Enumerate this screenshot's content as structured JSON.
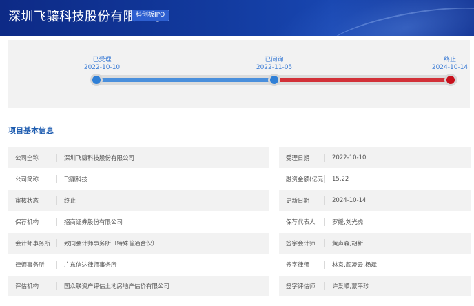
{
  "header": {
    "company_name": "深圳飞骧科技股份有限公司",
    "board_badge": "科创板IPO"
  },
  "timeline": {
    "stages": [
      {
        "label": "已受理",
        "date": "2022-10-10"
      },
      {
        "label": "已问询",
        "date": "2022-11-05"
      },
      {
        "label": "终止",
        "date": "2024-10-14"
      }
    ],
    "colors": {
      "completed": "#2f7fd6",
      "terminated": "#c8101c"
    }
  },
  "section": {
    "title": "项目基本信息"
  },
  "info_left": [
    {
      "key": "公司全称",
      "value": "深圳飞骧科技股份有限公司"
    },
    {
      "key": "公司简称",
      "value": "飞骧科技"
    },
    {
      "key": "审核状态",
      "value": "终止"
    },
    {
      "key": "保荐机构",
      "value": "招商证券股份有限公司"
    },
    {
      "key": "会计师事务所",
      "value": "致同会计师事务所（特殊普通合伙）"
    },
    {
      "key": "律师事务所",
      "value": "广东信达律师事务所"
    },
    {
      "key": "评估机构",
      "value": "国众联资产评估土地房地产估价有限公司"
    }
  ],
  "info_right": [
    {
      "key": "受理日期",
      "value": "2022-10-10"
    },
    {
      "key": "融资金额(亿元)",
      "value": "15.22"
    },
    {
      "key": "更新日期",
      "value": "2024-10-14"
    },
    {
      "key": "保荐代表人",
      "value": "罗媛,刘光虎"
    },
    {
      "key": "签字会计师",
      "value": "黄声森,胡新"
    },
    {
      "key": "签字律师",
      "value": "林意,颜凌云,杨斌"
    },
    {
      "key": "签字评估师",
      "value": "许爱顺,蒙平珍"
    }
  ]
}
